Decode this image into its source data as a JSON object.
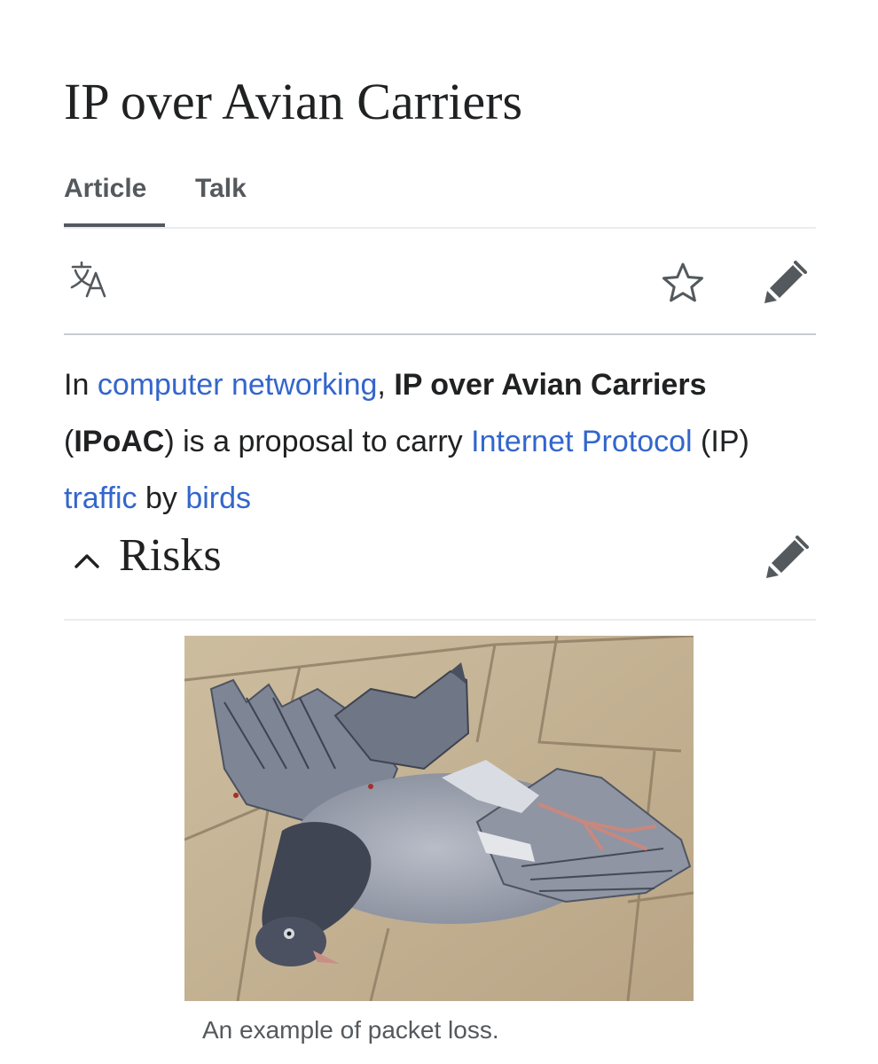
{
  "page": {
    "title": "IP over Avian Carriers"
  },
  "tabs": [
    {
      "label": "Article",
      "selected": true
    },
    {
      "label": "Talk",
      "selected": false
    }
  ],
  "toolbar": {
    "icons": [
      "language-icon",
      "star-icon",
      "pencil-icon"
    ]
  },
  "lead": {
    "t1": "In ",
    "link_computer_networking": "computer networking",
    "t2": ", ",
    "bold_name": "IP over Avian Carriers",
    "t3": " (",
    "bold_abbr": "IPoAC",
    "t4": ") is a proposal to carry ",
    "link_internet_protocol": "Internet Protocol",
    "t5": " (IP) ",
    "link_traffic": "traffic",
    "t6": " by ",
    "link_birds": "birds"
  },
  "section": {
    "title": "Risks",
    "expanded": true
  },
  "figure": {
    "caption": "An example of packet loss."
  },
  "colors": {
    "link": "#3366cc",
    "text": "#202122",
    "icon": "#54595d",
    "tab_underline": "#54595d",
    "divider": "#c8ccd1"
  }
}
